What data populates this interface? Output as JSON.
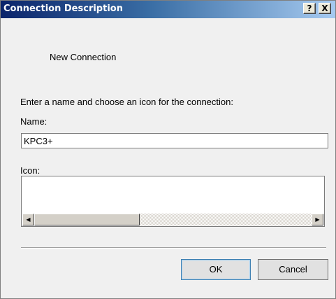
{
  "window": {
    "title": "Connection Description",
    "help_label": "?",
    "close_label": "X"
  },
  "header": {
    "text": "New Connection"
  },
  "form": {
    "instruction": "Enter a name and choose an icon for the connection:",
    "name_label": "Name:",
    "name_value": "KPC3+",
    "icon_label": "Icon:"
  },
  "scrollbar": {
    "left_arrow": "◀",
    "right_arrow": "▶"
  },
  "buttons": {
    "ok_label": "OK",
    "cancel_label": "Cancel"
  },
  "colors": {
    "titlebar_start": "#0b246b",
    "titlebar_end": "#a6caf0",
    "dialog_bg": "#f0f0f0"
  }
}
